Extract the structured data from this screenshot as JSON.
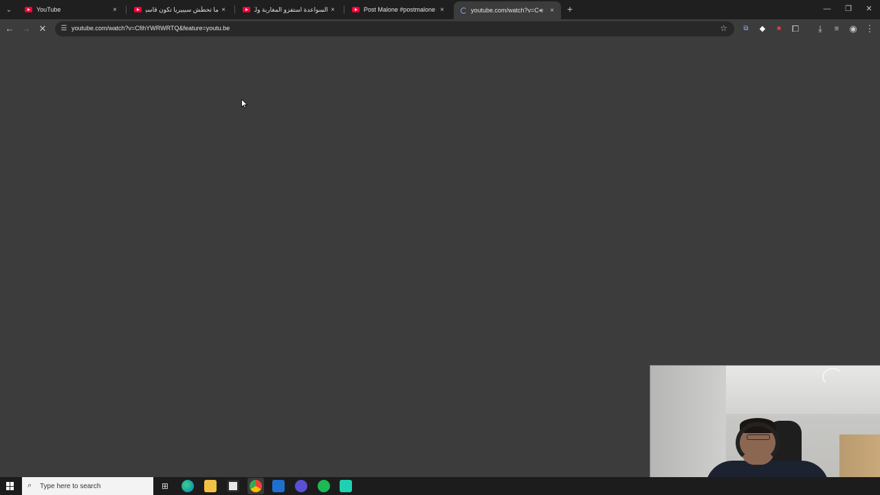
{
  "browser": {
    "tabs": [
      {
        "label": "YouTube",
        "close": "×"
      },
      {
        "label": "ما تحطّش سيبيريا تكون قاسية يو",
        "close": "×"
      },
      {
        "label": "السواعدة استفزو المغاربة ولكن ال",
        "close": "×"
      },
      {
        "label": "Post Malone #postmalone #mo",
        "close": "×"
      },
      {
        "label": "youtube.com/watch?v=CfihY",
        "close": "×"
      }
    ],
    "new_tab": "+",
    "window": {
      "minimize": "—",
      "restore": "❐",
      "close": "✕"
    },
    "url": "youtube.com/watch?v=CfihYWRWRTQ&feature=youtu.be"
  },
  "taskbar": {
    "search_placeholder": "Type here to search"
  }
}
